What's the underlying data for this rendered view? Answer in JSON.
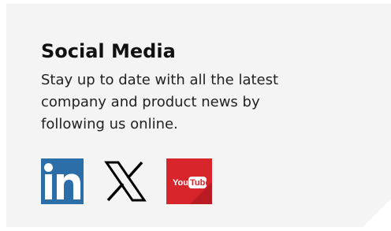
{
  "social": {
    "title": "Social Media",
    "description": "Stay up to date with all the latest company and product news by following us online.",
    "links": [
      {
        "name": "LinkedIn",
        "icon": "linkedin-icon",
        "color": "#2b6ea8"
      },
      {
        "name": "X",
        "icon": "x-icon",
        "color": "#000000"
      },
      {
        "name": "YouTube",
        "icon": "youtube-icon",
        "color": "#d8252b",
        "badge_text": "YouTube"
      }
    ]
  }
}
